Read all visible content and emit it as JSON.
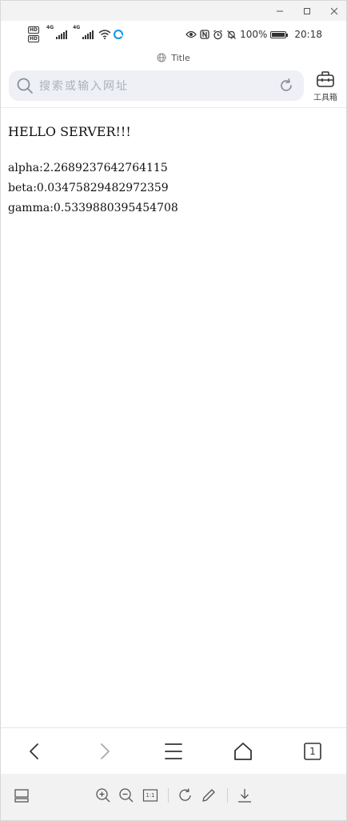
{
  "status_bar": {
    "hd_label": "HD",
    "network_label": "4G",
    "battery_percent": "100%",
    "time": "20:18"
  },
  "page": {
    "title": "Title"
  },
  "address_bar": {
    "placeholder": "搜索或输入网址"
  },
  "toolbox": {
    "label": "工具箱"
  },
  "content": {
    "heading": "HELLO SERVER!!!",
    "lines": [
      "alpha:2.2689237642764115",
      "beta:0.03475829482972359",
      "gamma:0.5339880395454708"
    ]
  },
  "tab_count": "1",
  "zoom_reset_label": "1:1",
  "colors": {
    "address_bg": "#eef0f5",
    "toolbar_bg": "#f2f2f2",
    "icon": "#333333"
  }
}
